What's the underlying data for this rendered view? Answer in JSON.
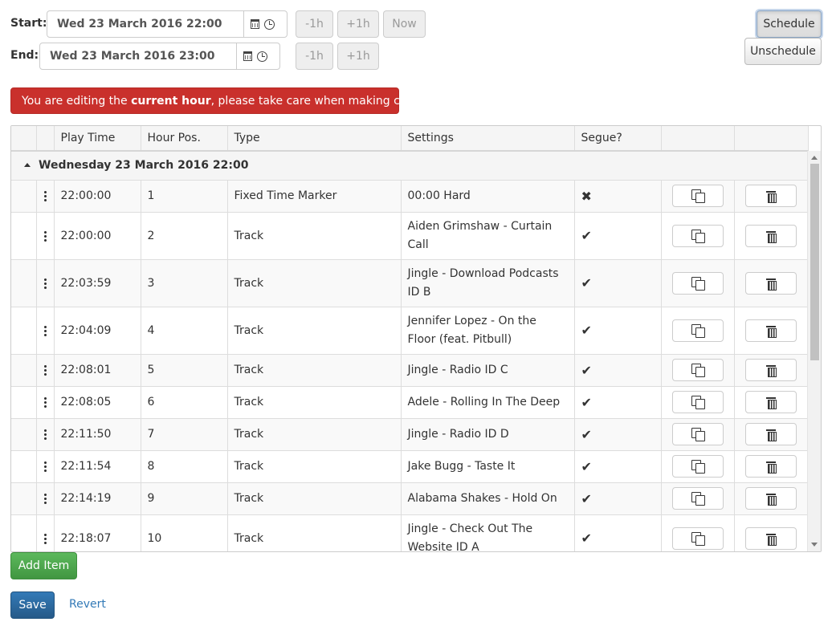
{
  "schedule": {
    "start_label": "Start:",
    "start_value": "Wed 23 March 2016 22:00",
    "end_label": "End:",
    "end_value": "Wed 23 March 2016 23:00",
    "minus_label": "-1h",
    "plus_label": "+1h",
    "now_label": "Now",
    "schedule_button": "Schedule",
    "unschedule_button": "Unschedule"
  },
  "alert": {
    "prefix": "You are editing the ",
    "strong": "current hour",
    "suffix": ", please take care when making changes."
  },
  "table": {
    "headers": [
      "",
      "",
      "Play Time",
      "Hour Pos.",
      "Type",
      "Settings",
      "Segue?",
      "",
      ""
    ],
    "group_label": "Wednesday 23 March 2016 22:00",
    "rows": [
      {
        "time": "22:00:00",
        "pos": "1",
        "type": "Fixed Time Marker",
        "settings": "00:00 Hard",
        "segue": "✖"
      },
      {
        "time": "22:00:00",
        "pos": "2",
        "type": "Track",
        "settings": "Aiden Grimshaw - Curtain Call",
        "segue": "✔"
      },
      {
        "time": "22:03:59",
        "pos": "3",
        "type": "Track",
        "settings": "Jingle - Download Podcasts ID B",
        "segue": "✔"
      },
      {
        "time": "22:04:09",
        "pos": "4",
        "type": "Track",
        "settings": "Jennifer Lopez - On the Floor (feat. Pitbull)",
        "segue": "✔"
      },
      {
        "time": "22:08:01",
        "pos": "5",
        "type": "Track",
        "settings": "Jingle - Radio ID C",
        "segue": "✔"
      },
      {
        "time": "22:08:05",
        "pos": "6",
        "type": "Track",
        "settings": "Adele - Rolling In The Deep",
        "segue": "✔"
      },
      {
        "time": "22:11:50",
        "pos": "7",
        "type": "Track",
        "settings": "Jingle - Radio ID D",
        "segue": "✔"
      },
      {
        "time": "22:11:54",
        "pos": "8",
        "type": "Track",
        "settings": "Jake Bugg - Taste It",
        "segue": "✔"
      },
      {
        "time": "22:14:19",
        "pos": "9",
        "type": "Track",
        "settings": "Alabama Shakes - Hold On",
        "segue": "✔"
      },
      {
        "time": "22:18:07",
        "pos": "10",
        "type": "Track",
        "settings": "Jingle - Check Out The Website ID A",
        "segue": "✔"
      },
      {
        "time": "",
        "pos": "",
        "type": "",
        "settings": "",
        "segue": ""
      }
    ]
  },
  "footer": {
    "add_item": "Add Item",
    "save": "Save",
    "revert": "Revert"
  },
  "icons": {
    "calendar": "calendar-icon",
    "clock": "clock-icon",
    "drag": "drag-handle-icon",
    "copy": "copy-icon",
    "delete": "trash-icon",
    "collapse": "caret-up-icon"
  },
  "colors": {
    "danger": "#c9302c",
    "success": "#449d44",
    "primary": "#337ab7"
  }
}
